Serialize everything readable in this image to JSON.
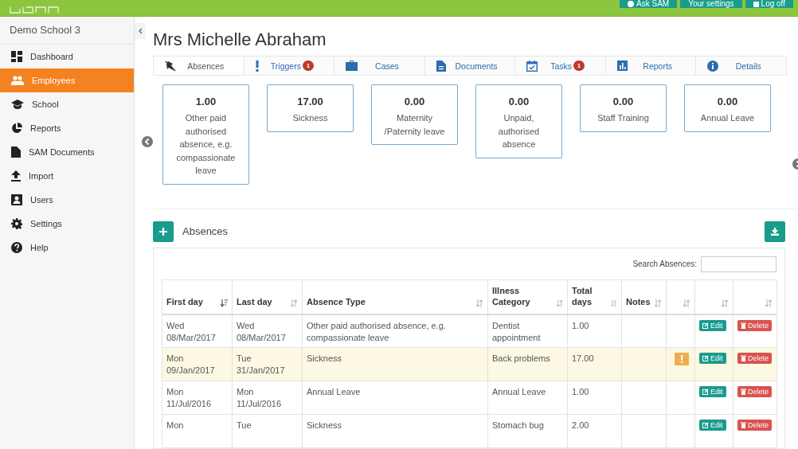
{
  "top_bar": {
    "buttons": [
      {
        "label": "Ask SAM"
      },
      {
        "label": "Your settings"
      },
      {
        "label": "Log off"
      }
    ]
  },
  "sidebar": {
    "school": "Demo School 3",
    "items": [
      {
        "label": "Dashboard",
        "selected": false
      },
      {
        "label": "Employees",
        "selected": true
      },
      {
        "label": "School",
        "selected": false
      },
      {
        "label": "Reports",
        "selected": false
      },
      {
        "label": "SAM Documents",
        "selected": false
      },
      {
        "label": "Import",
        "selected": false
      },
      {
        "label": "Users",
        "selected": false
      },
      {
        "label": "Settings",
        "selected": false
      },
      {
        "label": "Help",
        "selected": false
      }
    ]
  },
  "page_title": "Mrs Michelle Abraham",
  "tabs": [
    {
      "label": "Absences",
      "selected": true
    },
    {
      "label": "Triggers",
      "badge": "1",
      "selected": false
    },
    {
      "label": "Cases",
      "selected": false
    },
    {
      "label": "Documents",
      "selected": false
    },
    {
      "label": "Tasks",
      "badge": "1",
      "selected": false
    },
    {
      "label": "Reports",
      "selected": false
    },
    {
      "label": "Details",
      "selected": false
    }
  ],
  "summary_cards": [
    {
      "value": "1.00",
      "label": "Other paid authorised absence, e.g. compassionate leave"
    },
    {
      "value": "17.00",
      "label": "Sickness"
    },
    {
      "value": "0.00",
      "label": "Maternity /Paternity leave"
    },
    {
      "value": "0.00",
      "label": "Unpaid, authorised absence"
    },
    {
      "value": "0.00",
      "label": "Staff Training"
    },
    {
      "value": "0.00",
      "label": "Annual Leave"
    }
  ],
  "absences": {
    "title": "Absences",
    "search_label": "Search Absences:",
    "columns": [
      {
        "label": "First day",
        "sorted": true
      },
      {
        "label": "Last day",
        "sorted": false
      },
      {
        "label": "Absence Type",
        "sorted": false
      },
      {
        "label": "Illness Category",
        "sorted": false
      },
      {
        "label": "Total days",
        "sorted": false
      },
      {
        "label": "Notes",
        "sorted": false
      },
      {
        "sorted": false
      },
      {
        "sorted": false
      },
      {
        "sorted": false
      }
    ],
    "rows": [
      {
        "first_day": "Wed 08/Mar/2017",
        "last_day": "Wed 08/Mar/2017",
        "absence_type": "Other paid authorised absence, e.g. compassionate leave",
        "illness_category": "Dentist appointment",
        "total_days": "1.00",
        "warning": false,
        "highlighted": false,
        "edit": "Edit",
        "delete": "Delete"
      },
      {
        "first_day": "Mon 09/Jan/2017",
        "last_day": "Tue 31/Jan/2017",
        "absence_type": "Sickness",
        "illness_category": "Back problems",
        "total_days": "17.00",
        "warning": true,
        "highlighted": true,
        "edit": "Edit",
        "delete": "Delete"
      },
      {
        "first_day": "Mon 11/Jul/2016",
        "last_day": "Mon 11/Jul/2016",
        "absence_type": "Annual Leave",
        "illness_category": "Annual Leave",
        "total_days": "1.00",
        "warning": false,
        "highlighted": false,
        "edit": "Edit",
        "delete": "Delete"
      },
      {
        "first_day": "Mon",
        "last_day": "Tue",
        "absence_type": "Sickness",
        "illness_category": "Stomach bug",
        "total_days": "2.00",
        "warning": false,
        "highlighted": false,
        "edit": "Edit",
        "delete": "Delete"
      }
    ]
  }
}
